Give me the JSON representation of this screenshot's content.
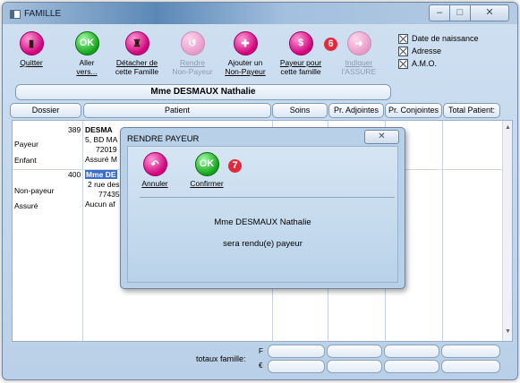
{
  "window": {
    "title": "FAMILLE",
    "controls": {
      "minimize": "–",
      "maximize": "□",
      "close": "✕"
    }
  },
  "toolbar": [
    {
      "label1": "Quitter",
      "label2": "",
      "icon": "exit-door-icon",
      "enabled": true
    },
    {
      "label1": "Aller",
      "label2": "vers...",
      "icon": "ok-go-icon",
      "enabled": true
    },
    {
      "label1": "Détacher de",
      "label2": "cette Famille",
      "icon": "detach-family-icon",
      "enabled": true
    },
    {
      "label1": "Rendre",
      "label2": "Non-Payeur",
      "icon": "make-non-payer-icon",
      "enabled": false
    },
    {
      "label1": "Ajouter un",
      "label2": "Non-Payeur",
      "icon": "add-non-payer-icon",
      "enabled": true
    },
    {
      "label1": "Payeur pour",
      "label2": "cette famille",
      "icon": "payer-for-family-icon",
      "enabled": true
    },
    {
      "label1": "Indiquer",
      "label2": "l'ASSURE",
      "icon": "indicate-insured-icon",
      "enabled": false
    }
  ],
  "annotations": {
    "payer_step": "6",
    "confirm_step": "7"
  },
  "checkboxes": [
    {
      "label": "Date de naissance",
      "checked": true
    },
    {
      "label": "Adresse",
      "checked": true
    },
    {
      "label": "A.M.O.",
      "checked": true
    }
  ],
  "family_name": "Mme DESMAUX Nathalie",
  "columns": [
    "Dossier",
    "Patient",
    "Soins",
    "Pr. Adjointes",
    "Pr. Conjointes",
    "Total Patient:"
  ],
  "rows": [
    {
      "dossier": "389",
      "role1": "Payeur",
      "role2": "Enfant",
      "line1": "DESMA",
      "line2": "5, BD MA",
      "line3": "72019",
      "line4": "Assuré M",
      "selected": false
    },
    {
      "dossier": "400",
      "role1": "Non-payeur",
      "role2": "Assuré",
      "line1": "Mme DE",
      "line2": "2 rue des",
      "line3": "77435",
      "line4": "Aucun af",
      "selected": true
    }
  ],
  "footer": {
    "label": "totaux famille:",
    "row1_unit": "F",
    "row2_unit": "€"
  },
  "dialog": {
    "title": "RENDRE PAYEUR",
    "close": "✕",
    "cancel_label": "Annuler",
    "confirm_label": "Confirmer",
    "message_line1": "Mme DESMAUX Nathalie",
    "message_line2": "sera rendu(e) payeur"
  },
  "colors": {
    "accent_pink": "#d1007b",
    "accent_green": "#13a31a",
    "badge_red": "#e32a3d",
    "selection_blue": "#3a6fcf"
  }
}
